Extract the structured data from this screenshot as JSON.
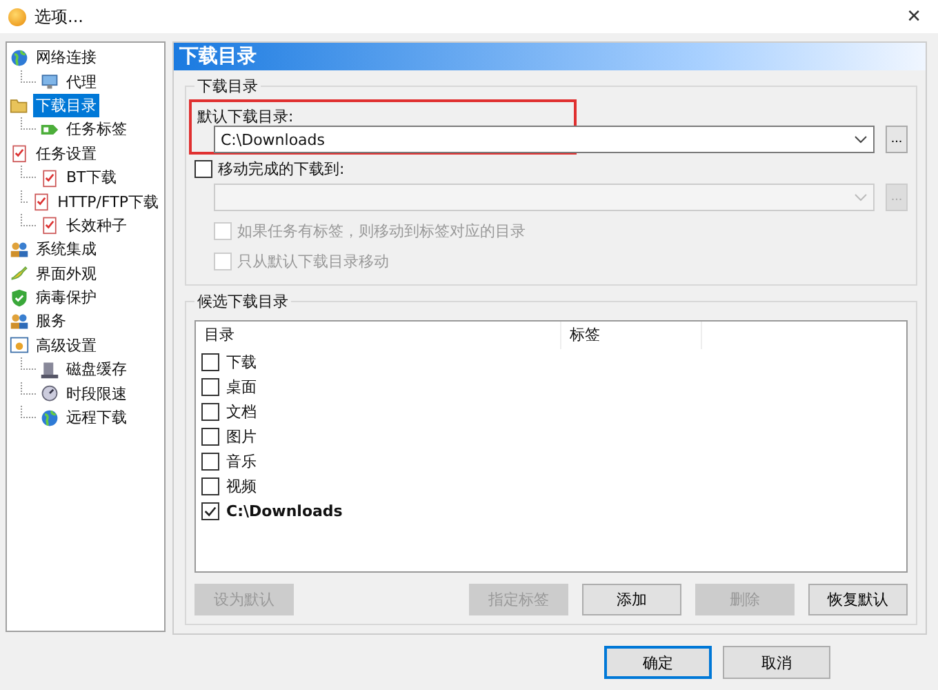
{
  "window": {
    "title": "选项...",
    "close": "✕"
  },
  "tree": [
    {
      "label": "网络连接",
      "kind": "globe",
      "selected": false,
      "children": [
        {
          "label": "代理",
          "kind": "monitor",
          "selected": false
        }
      ]
    },
    {
      "label": "下载目录",
      "kind": "folder",
      "selected": true,
      "children": [
        {
          "label": "任务标签",
          "kind": "tag",
          "selected": false
        }
      ]
    },
    {
      "label": "任务设置",
      "kind": "clipboard",
      "selected": false,
      "children": [
        {
          "label": "BT下载",
          "kind": "clipboard",
          "selected": false
        },
        {
          "label": "HTTP/FTP下载",
          "kind": "clipboard",
          "selected": false
        },
        {
          "label": "长效种子",
          "kind": "clipboard",
          "selected": false
        }
      ]
    },
    {
      "label": "系统集成",
      "kind": "people",
      "selected": false
    },
    {
      "label": "界面外观",
      "kind": "brush",
      "selected": false
    },
    {
      "label": "病毒保护",
      "kind": "shield",
      "selected": false
    },
    {
      "label": "服务",
      "kind": "people",
      "selected": false
    },
    {
      "label": "高级设置",
      "kind": "panel",
      "selected": false,
      "children": [
        {
          "label": "磁盘缓存",
          "kind": "disk",
          "selected": false
        },
        {
          "label": "时段限速",
          "kind": "gauge",
          "selected": false
        },
        {
          "label": "远程下载",
          "kind": "globe",
          "selected": false
        }
      ]
    }
  ],
  "panel": {
    "title": "下载目录",
    "group1": {
      "title": "下载目录",
      "default_label": "默认下载目录:",
      "default_value": "C:\\Downloads",
      "browse": "...",
      "move": {
        "label": "移动完成的下载到:",
        "checked": false,
        "browse": "..."
      },
      "options": [
        {
          "label": "如果任务有标签，则移动到标签对应的目录",
          "checked": false,
          "disabled": true
        },
        {
          "label": "只从默认下载目录移动",
          "checked": false,
          "disabled": true
        }
      ]
    },
    "group2": {
      "title": "候选下载目录",
      "columns": [
        "目录",
        "标签"
      ],
      "rows": [
        {
          "name": "下载",
          "checked": false,
          "bold": false
        },
        {
          "name": "桌面",
          "checked": false,
          "bold": false
        },
        {
          "name": "文档",
          "checked": false,
          "bold": false
        },
        {
          "name": "图片",
          "checked": false,
          "bold": false
        },
        {
          "name": "音乐",
          "checked": false,
          "bold": false
        },
        {
          "name": "视频",
          "checked": false,
          "bold": false
        },
        {
          "name": "C:\\Downloads",
          "checked": true,
          "bold": true
        }
      ],
      "buttons": [
        {
          "label": "设为默认",
          "disabled": true
        },
        {
          "label": "指定标签",
          "disabled": true
        },
        {
          "label": "添加",
          "disabled": false
        },
        {
          "label": "删除",
          "disabled": true
        },
        {
          "label": "恢复默认",
          "disabled": false
        }
      ]
    }
  },
  "footer": {
    "buttons": [
      {
        "label": "确定",
        "primary": true
      },
      {
        "label": "取消",
        "primary": false
      }
    ]
  }
}
